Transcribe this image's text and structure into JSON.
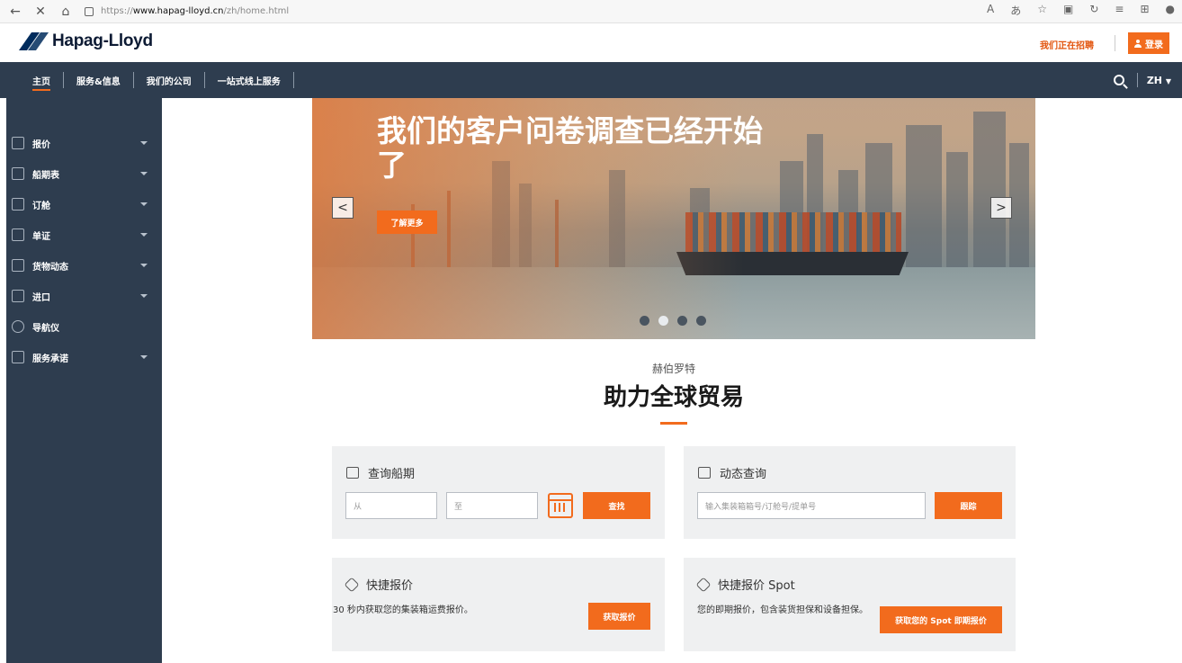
{
  "browser": {
    "url": "https://www.hapag-lloyd.cn/zh/home.html",
    "url_prefix": "https://",
    "url_host": "www.hapag-lloyd.cn",
    "url_path": "/zh/home.html"
  },
  "header": {
    "brand": "Hapag-Lloyd",
    "career_link": "我们正在招聘",
    "login_label": "登录"
  },
  "nav": {
    "items": [
      "主页",
      "服务&信息",
      "我们的公司",
      "一站式线上服务"
    ],
    "language": "ZH"
  },
  "sidebar": {
    "items": [
      {
        "label": "报价",
        "icon": "tag-icon",
        "has_submenu": true
      },
      {
        "label": "船期表",
        "icon": "calendar-icon",
        "has_submenu": true
      },
      {
        "label": "订舱",
        "icon": "booking-icon",
        "has_submenu": true
      },
      {
        "label": "单证",
        "icon": "document-icon",
        "has_submenu": true
      },
      {
        "label": "货物动态",
        "icon": "map-icon",
        "has_submenu": true
      },
      {
        "label": "进口",
        "icon": "import-icon",
        "has_submenu": true
      },
      {
        "label": "导航仪",
        "icon": "compass-icon",
        "has_submenu": false
      },
      {
        "label": "服务承诺",
        "icon": "service-icon",
        "has_submenu": true
      }
    ]
  },
  "hero": {
    "title": "我们的客户问卷调查已经开始了",
    "cta": "了解更多",
    "slides": 4,
    "active_slide": 2
  },
  "intro": {
    "subtitle": "赫伯罗特",
    "title": "助力全球贸易"
  },
  "schedule_card": {
    "title": "查询船期",
    "from_placeholder": "从",
    "to_placeholder": "至",
    "button": "查找"
  },
  "tracking_card": {
    "title": "动态查询",
    "placeholder": "输入集装箱箱号/订舱号/提单号",
    "button": "跟踪"
  },
  "quick_quote_card": {
    "title": "快捷报价",
    "text": "30 秒内获取您的集装箱运费报价。",
    "button": "获取报价"
  },
  "spot_card": {
    "title": "快捷报价 Spot",
    "text": "您的即期报价，包含装货担保和设备担保。",
    "button": "获取您的 Spot 即期报价"
  },
  "colors": {
    "accent": "#f26b1d",
    "nav_bg": "#2e3d4f",
    "card_bg": "#eff0f1"
  }
}
